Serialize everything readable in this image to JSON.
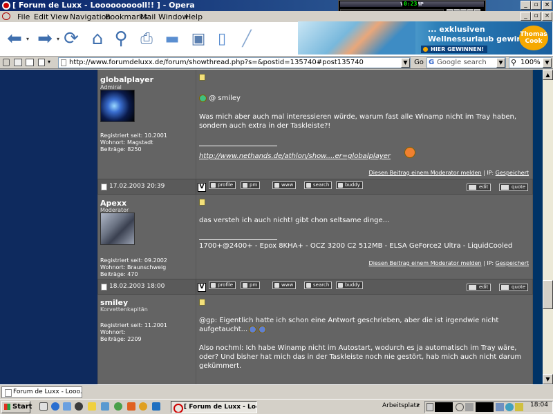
{
  "window": {
    "title": "[ Forum de Luxx - Loooooooooll!! ] - Opera"
  },
  "winamp": {
    "title": "WINAMP",
    "time": "0:23"
  },
  "menu": [
    "File",
    "Edit",
    "View",
    "Navigation",
    "Bookmarks",
    "Mail",
    "Window",
    "Help"
  ],
  "ad": {
    "line1": "... exklusiven",
    "line2": "Wellnessurlaub gewinnen!",
    "cta": "HIER GEWINNEN!",
    "brand": "Thomas Cook"
  },
  "addressbar": {
    "url": "http://www.forumdeluxx.de/forum/showthread.php?s=&postid=135740#post135740",
    "go": "Go",
    "search_placeholder": "Google search",
    "zoom": "100%"
  },
  "posts": [
    {
      "username": "globalplayer",
      "rank": "Admiral",
      "registered": "Registriert seit: 10.2001",
      "location": "Wohnort: Magstadt",
      "posts": "Beiträge: 8250",
      "greeting": "@ smiley",
      "body": "Was mich aber auch mal interessieren würde, warum fast alle Winamp nicht im Tray haben, sondern auch extra in der Taskleiste?!",
      "signature": "http://www.nethands.de/athlon/show....er=globalplayer",
      "report": "Diesen Beitrag einem Moderator melden",
      "ip_label": " | IP: ",
      "ip_value": "Gespeichert",
      "date": "17.02.2003 20:39"
    },
    {
      "username": "Apexx",
      "rank": "Moderator",
      "registered": "Registriert seit: 09.2002",
      "location": "Wohnort: Braunschweig",
      "posts": "Beiträge: 470",
      "body": "das versteh ich auch nicht! gibt chon seltsame dinge...",
      "signature": "1700+@2400+ - Epox 8KHA+ - OCZ 3200 C2 512MB - ELSA GeForce2 Ultra - LiquidCooled",
      "report": "Diesen Beitrag einem Moderator melden",
      "ip_label": " | IP: ",
      "ip_value": "Gespeichert",
      "date": "18.02.2003 18:00"
    },
    {
      "username": "smiley",
      "rank": "Korvettenkapitän",
      "registered": "Registriert seit: 11.2001",
      "location": "Wohnort:",
      "posts": "Beiträge: 2209",
      "body1": "@gp: Eigentlich hatte ich schon eine Antwort geschrieben, aber die ist irgendwie nicht aufgetaucht...",
      "body2": "Also nochml: Ich habe Winamp nicht im Autostart, wodurch es ja automatisch im Tray wäre, oder? Und bisher hat mich das in der Taskleiste noch nie gestört, hab mich auch nicht darum gekümmert."
    }
  ],
  "post_buttons": {
    "profile": "profile",
    "pm": "pm",
    "www": "www",
    "search": "search",
    "buddy": "buddy",
    "edit": "edit",
    "quote": "quote",
    "v": "V"
  },
  "tabbar": {
    "tab1": "Forum de Luxx - Looo..."
  },
  "taskbar": {
    "start": "Start",
    "task": "[ Forum de Luxx - Loo...",
    "arbeitsplatz": "Arbeitsplatz",
    "clock": "18:04"
  }
}
